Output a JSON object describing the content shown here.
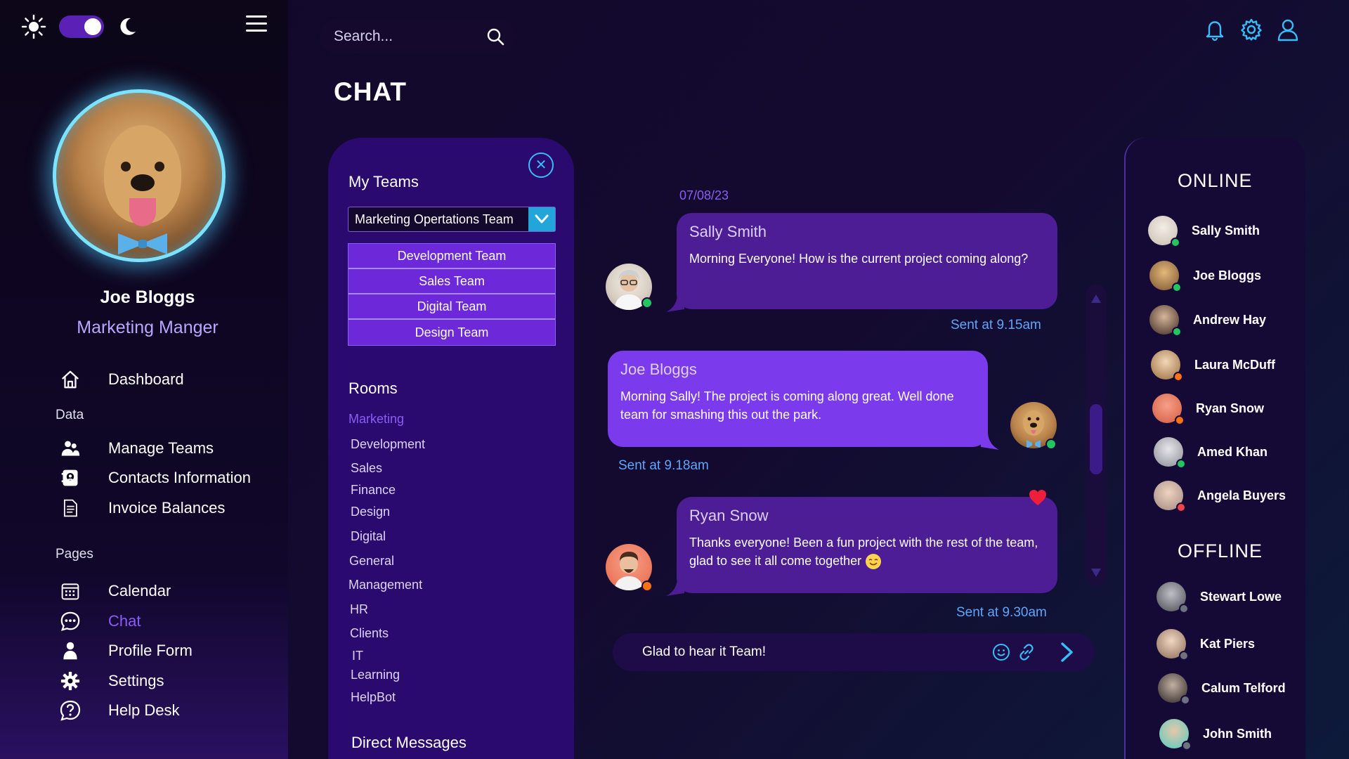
{
  "sidebar": {
    "profile": {
      "name": "Joe Bloggs",
      "role": "Marketing Manger"
    },
    "items": [
      {
        "label": "Dashboard",
        "icon": "home-icon"
      },
      {
        "label": "Manage Teams",
        "icon": "users-icon"
      },
      {
        "label": "Contacts Information",
        "icon": "contacts-icon"
      },
      {
        "label": "Invoice Balances",
        "icon": "document-icon"
      },
      {
        "label": "Calendar",
        "icon": "calendar-icon"
      },
      {
        "label": "Chat",
        "icon": "chat-icon",
        "active": true
      },
      {
        "label": "Profile Form",
        "icon": "person-icon"
      },
      {
        "label": "Settings",
        "icon": "gear-icon"
      },
      {
        "label": "Help Desk",
        "icon": "help-icon"
      }
    ],
    "sections": {
      "data": "Data",
      "pages": "Pages"
    }
  },
  "search": {
    "placeholder": "Search..."
  },
  "page": {
    "title": "CHAT"
  },
  "teams": {
    "label": "My Teams",
    "selected": "Marketing Opertations Team",
    "options": [
      "Development Team",
      "Sales Team",
      "Digital Team",
      "Design Team"
    ],
    "rooms_label": "Rooms",
    "rooms": [
      "Marketing",
      "Development",
      "Sales",
      "Finance",
      "Design",
      "Digital",
      "General",
      "Management",
      "HR",
      "Clients",
      "IT",
      "Learning",
      "HelpBot"
    ],
    "active_room": "Marketing",
    "dm_label": "Direct Messages"
  },
  "chat": {
    "date": "07/08/23",
    "messages": [
      {
        "sender": "Sally Smith",
        "text": "Morning Everyone! How is the current project coming along?",
        "sent": "Sent at 9.15am"
      },
      {
        "sender": "Joe Bloggs",
        "text": "Morning Sally! The project is coming along great. Well done team for smashing this out the park.",
        "sent": "Sent at 9.18am"
      },
      {
        "sender": "Ryan Snow",
        "text": "Thanks everyone! Been a fun project with the rest of the team, glad to see it all come together",
        "sent": "Sent at 9.30am"
      }
    ],
    "composer_text": "Glad to hear it Team!"
  },
  "users": {
    "online_label": "ONLINE",
    "offline_label": "OFFLINE",
    "online": [
      {
        "name": "Sally Smith",
        "status": "online"
      },
      {
        "name": "Joe Bloggs",
        "status": "online"
      },
      {
        "name": "Andrew Hay",
        "status": "online"
      },
      {
        "name": "Laura McDuff",
        "status": "away"
      },
      {
        "name": "Ryan Snow",
        "status": "away"
      },
      {
        "name": "Amed Khan",
        "status": "online"
      },
      {
        "name": "Angela Buyers",
        "status": "busy"
      }
    ],
    "offline": [
      {
        "name": "Stewart Lowe",
        "status": "offline"
      },
      {
        "name": "Kat Piers",
        "status": "offline"
      },
      {
        "name": "Calum Telford",
        "status": "offline"
      },
      {
        "name": "John Smith",
        "status": "offline"
      }
    ]
  },
  "colors": {
    "accent": "#8b5cf6",
    "online": "#22c55e",
    "away": "#f97316",
    "busy": "#ef4444",
    "offline": "#6b7280",
    "link": "#60a5fa"
  }
}
